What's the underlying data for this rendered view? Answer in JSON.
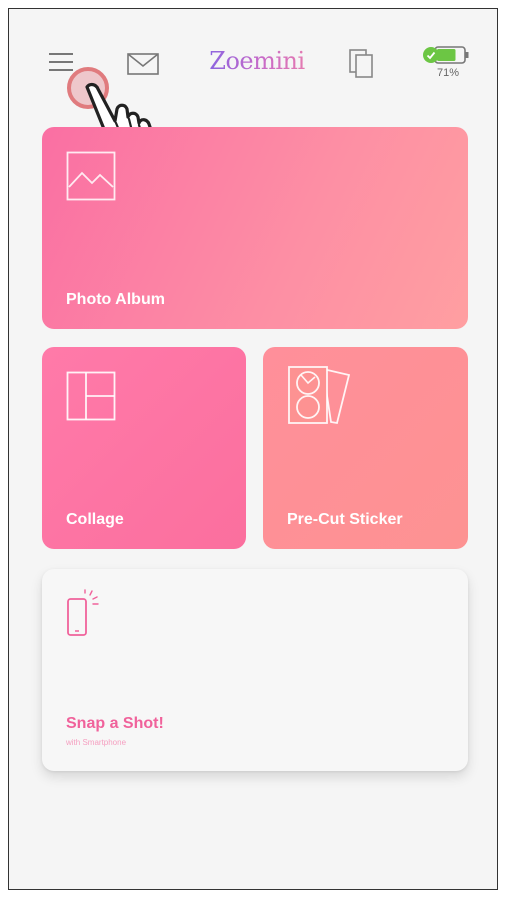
{
  "header": {
    "app_title": "Zoemini",
    "battery_percent": "71%",
    "battery_level": 0.71,
    "battery_color": "#6cc644"
  },
  "cards": {
    "photo_album": {
      "label": "Photo Album",
      "icon": "image-icon"
    },
    "collage": {
      "label": "Collage",
      "icon": "collage-layout-icon"
    },
    "sticker": {
      "label": "Pre-Cut Sticker",
      "icon": "sticker-sheet-icon"
    },
    "snap": {
      "label": "Snap a Shot!",
      "sublabel": "with Smartphone",
      "icon": "smartphone-icon"
    }
  },
  "colors": {
    "accent_pink": "#f0629b",
    "title_purple": "#9b6bd6",
    "touch_ring": "#e07b7e"
  }
}
